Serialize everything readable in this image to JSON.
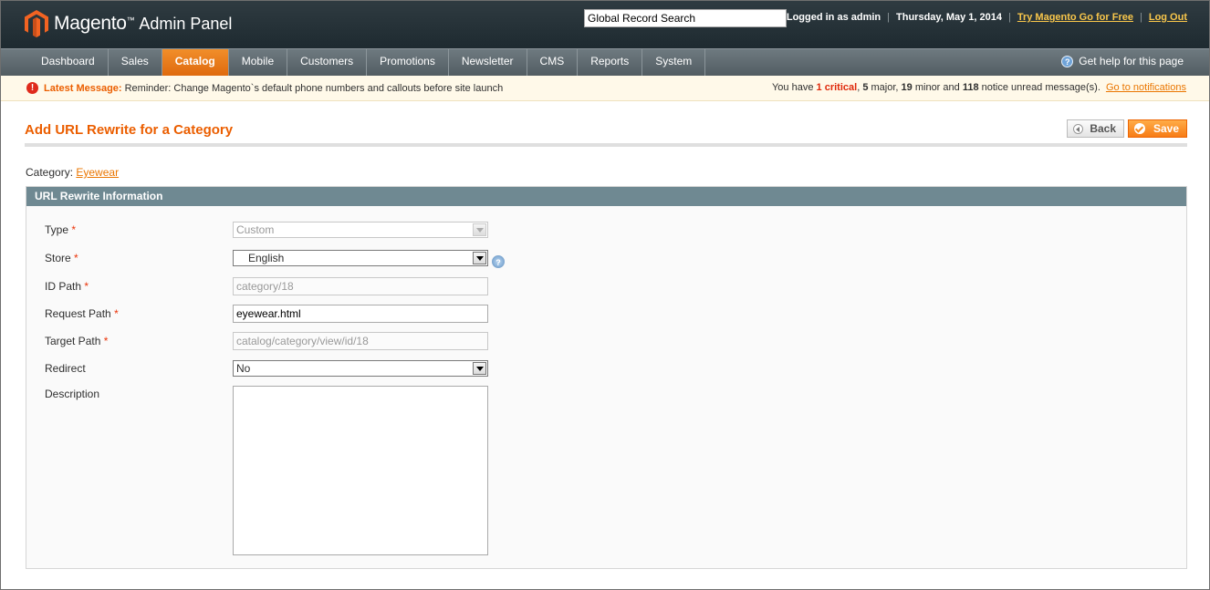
{
  "header": {
    "logo_name": "Magento",
    "logo_tm": "™",
    "logo_panel": "Admin Panel",
    "search_value": "Global Record Search",
    "logged_in": "Logged in as admin",
    "date": "Thursday, May 1, 2014",
    "try_link": "Try Magento Go for Free",
    "logout_link": "Log Out",
    "separator": "|"
  },
  "nav": {
    "items": [
      {
        "label": "Dashboard"
      },
      {
        "label": "Sales"
      },
      {
        "label": "Catalog"
      },
      {
        "label": "Mobile"
      },
      {
        "label": "Customers"
      },
      {
        "label": "Promotions"
      },
      {
        "label": "Newsletter"
      },
      {
        "label": "CMS"
      },
      {
        "label": "Reports"
      },
      {
        "label": "System"
      }
    ],
    "active": "Catalog",
    "help_label": "Get help for this page",
    "help_icon": "?"
  },
  "message": {
    "icon": "!",
    "label": "Latest Message:",
    "text": "Reminder: Change Magento`s default phone numbers and callouts before site launch",
    "summary_prefix": "You have",
    "critical_count": "1",
    "critical_label": "critical",
    "major_count": "5",
    "major_label": "major,",
    "minor_count": "19",
    "minor_label": "minor and",
    "notice_count": "118",
    "notice_label": "notice unread message(s).",
    "link": "Go to notifications"
  },
  "page": {
    "title": "Add URL Rewrite for a Category",
    "back_label": "Back",
    "save_label": "Save",
    "category_label": "Category:",
    "category_value": "Eyewear"
  },
  "section": {
    "title": "URL Rewrite Information",
    "required_mark": "*",
    "help_icon": "?",
    "fields": {
      "type": {
        "label": "Type",
        "value": "Custom"
      },
      "store": {
        "label": "Store",
        "value": "English"
      },
      "id_path": {
        "label": "ID Path",
        "value": "category/18"
      },
      "request_path": {
        "label": "Request Path",
        "value": "eyewear.html"
      },
      "target_path": {
        "label": "Target Path",
        "value": "catalog/category/view/id/18"
      },
      "redirect": {
        "label": "Redirect",
        "value": "No"
      },
      "description": {
        "label": "Description",
        "value": ""
      }
    }
  },
  "colors": {
    "accent": "#eb5e00",
    "nav_active": "#df6a0e",
    "section_head": "#6f8992",
    "header_bg": "#2f3b41"
  }
}
